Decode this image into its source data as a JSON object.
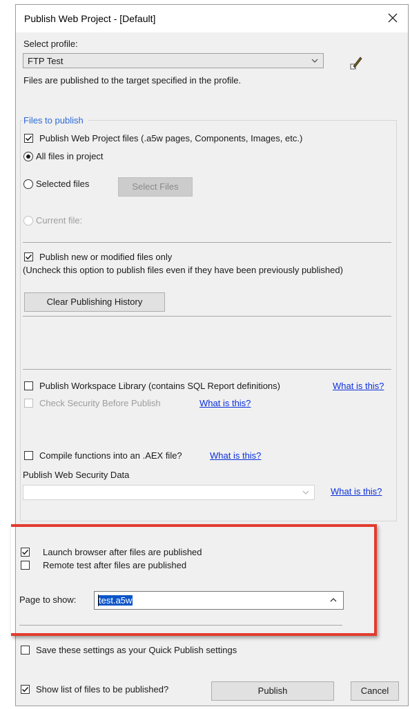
{
  "window": {
    "title": "Publish Web Project - [Default]"
  },
  "profile": {
    "label": "Select profile:",
    "selected": "FTP Test",
    "hint": "Files are published to the target specified in the profile."
  },
  "files": {
    "group_label": "Files to publish",
    "publish_project_files": {
      "label": "Publish Web Project files (.a5w pages, Components, Images, etc.)",
      "checked": true
    },
    "all_files": {
      "label": "All files in project",
      "selected": true
    },
    "selected_files": {
      "label": "Selected files",
      "selected": false
    },
    "select_files_button": "Select Files",
    "current_file": {
      "label": "Current file:",
      "enabled": false
    },
    "modified_only": {
      "label": "Publish new or modified files only",
      "checked": true
    },
    "modified_only_note": "(Uncheck this option to publish files even if they have been previously published)",
    "clear_history_button": "Clear Publishing History"
  },
  "workspace": {
    "publish_library": {
      "label": "Publish Workspace Library (contains SQL Report definitions)",
      "checked": false
    },
    "what_is_this_1": "What is this?",
    "check_security": {
      "label": "Check Security Before Publish",
      "enabled": false
    },
    "what_is_this_2": "What is this?",
    "compile_aex": {
      "label": "Compile functions into an .AEX file?",
      "checked": false
    },
    "what_is_this_3": "What is this?",
    "security_data_label": "Publish Web Security Data",
    "security_data_value": "",
    "what_is_this_4": "What is this?"
  },
  "launch": {
    "launch_browser": {
      "label": "Launch browser after files are published",
      "checked": true
    },
    "remote_test": {
      "label": "Remote test after files are published",
      "checked": false
    },
    "page_label": "Page to show:",
    "page_value": "test.a5w"
  },
  "footer": {
    "quick_publish": {
      "label": "Save these settings as your Quick Publish settings",
      "checked": false
    },
    "show_list": {
      "label": "Show list of files to be published?",
      "checked": true
    },
    "publish_button": "Publish",
    "cancel_button": "Cancel"
  },
  "colors": {
    "highlight_box": "#e23b2e",
    "group_label": "#2a6ad6",
    "link": "#0b2fdc",
    "selection": "#0b55c9"
  }
}
